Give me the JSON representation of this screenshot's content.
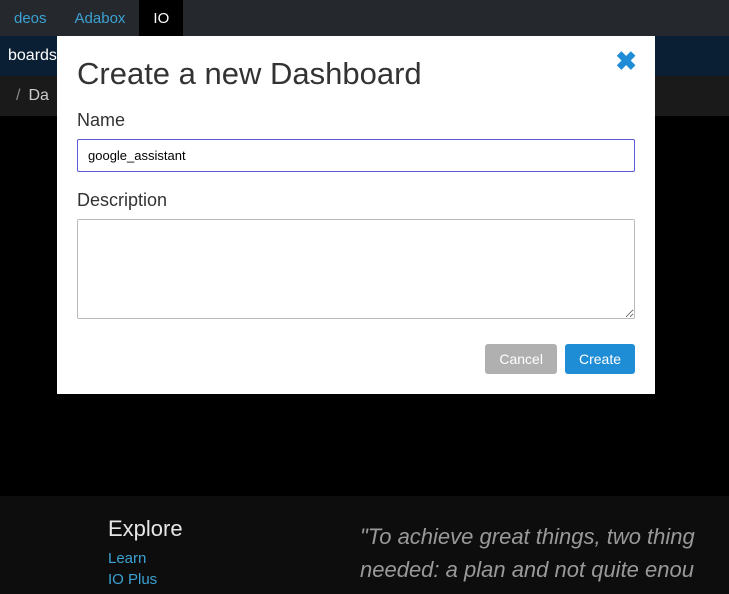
{
  "top_nav": {
    "items": [
      {
        "label": "deos"
      },
      {
        "label": "Adabox"
      },
      {
        "label": "IO"
      }
    ],
    "active_index": 2
  },
  "sub_nav": {
    "label": "boards"
  },
  "breadcrumb": {
    "current": "Da",
    "separator": "/"
  },
  "modal": {
    "title": "Create a new Dashboard",
    "name_label": "Name",
    "name_value": "google_assistant",
    "description_label": "Description",
    "description_value": "",
    "cancel_label": "Cancel",
    "create_label": "Create"
  },
  "footer": {
    "explore_heading": "Explore",
    "links": [
      {
        "label": "Learn"
      },
      {
        "label": "IO Plus"
      }
    ],
    "quote_line1": "\"To achieve great things, two thing",
    "quote_line2": "needed: a plan and not quite enou"
  }
}
